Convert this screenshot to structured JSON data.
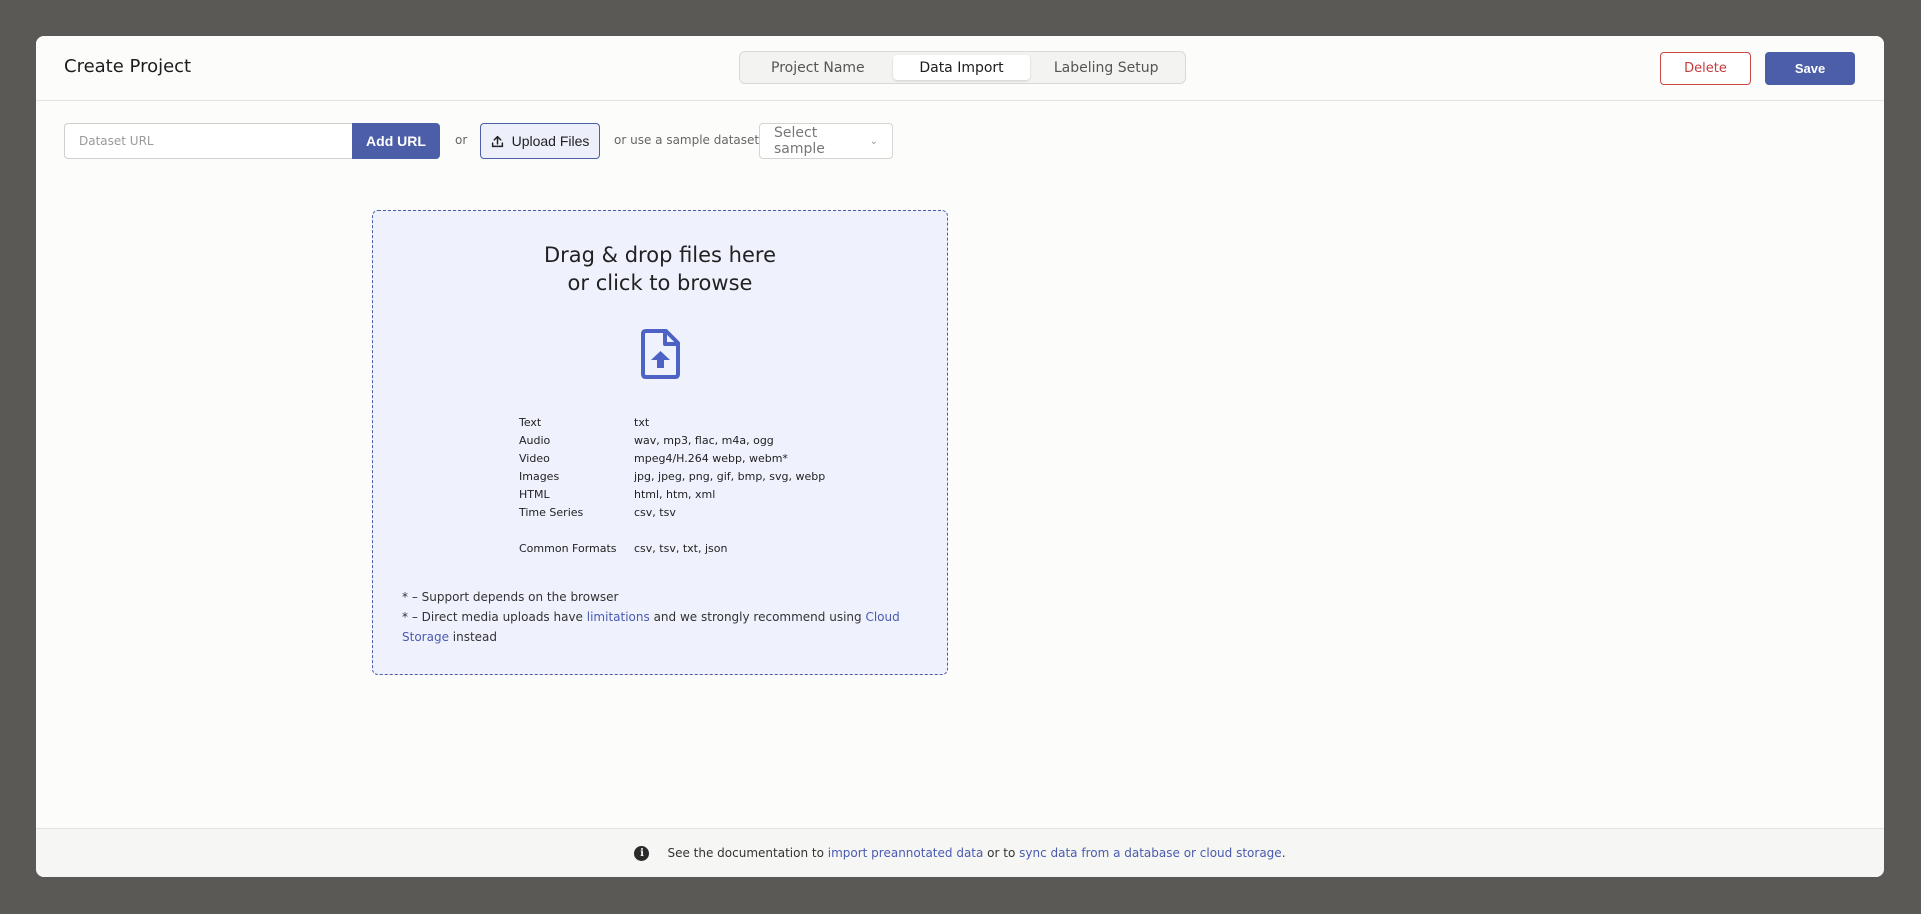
{
  "header": {
    "title": "Create Project",
    "steps": [
      "Project Name",
      "Data Import",
      "Labeling Setup"
    ],
    "active_step": "Data Import",
    "delete_label": "Delete",
    "save_label": "Save"
  },
  "toolbar": {
    "url_placeholder": "Dataset URL",
    "url_value": "",
    "add_url_label": "Add URL",
    "or_label": "or",
    "upload_label": "Upload Files",
    "sample_prefix": "or use a sample dataset",
    "sample_select": "Select sample"
  },
  "dropzone": {
    "title_line1": "Drag & drop files here",
    "title_line2": "or click to browse",
    "formats": [
      {
        "type": "Text",
        "ext": "txt"
      },
      {
        "type": "Audio",
        "ext": "wav, mp3, flac, m4a, ogg"
      },
      {
        "type": "Video",
        "ext": "mpeg4/H.264 webp, webm*"
      },
      {
        "type": "Images",
        "ext": "jpg, jpeg, png, gif, bmp, svg, webp"
      },
      {
        "type": "HTML",
        "ext": "html, htm, xml"
      },
      {
        "type": "Time Series",
        "ext": "csv, tsv"
      }
    ],
    "common": {
      "type": "Common Formats",
      "ext": "csv, tsv, txt, json"
    },
    "note1": "* – Support depends on the browser",
    "note2_a": "* – Direct media uploads have ",
    "note2_link1": "limitations",
    "note2_b": " and we strongly recommend using ",
    "note2_link2": "Cloud Storage",
    "note2_c": " instead"
  },
  "footer": {
    "text_a": "See the documentation to ",
    "link1": "import preannotated data",
    "text_b": " or to ",
    "link2": "sync data from a database or cloud storage",
    "text_c": "."
  },
  "colors": {
    "accent": "#4c5ea8",
    "danger": "#c43c3c",
    "dropzone_bg": "#eff2fd",
    "backdrop": "#5a5955"
  }
}
